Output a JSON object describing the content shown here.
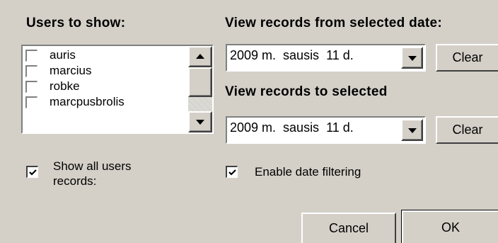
{
  "users_panel": {
    "heading": "Users to show:",
    "users": [
      {
        "name": "auris",
        "checked": false
      },
      {
        "name": "marcius",
        "checked": false
      },
      {
        "name": "robke",
        "checked": false
      },
      {
        "name": "marcpusbrolis",
        "checked": false
      }
    ],
    "show_all_label_line1": "Show all users",
    "show_all_label_line2": "records:",
    "show_all_checked": true
  },
  "date_from": {
    "heading": "View records from selected date:",
    "value": "2009 m.  sausis  11 d.",
    "clear_label": "Clear"
  },
  "date_to": {
    "heading": "View records to selected",
    "value": "2009 m.  sausis  11 d.",
    "clear_label": "Clear"
  },
  "enable_filter": {
    "label": "Enable date filtering",
    "checked": true
  },
  "buttons": {
    "cancel_label": "Cancel",
    "ok_label": "OK"
  },
  "icons": {
    "scroll_up": "triangle-up-icon",
    "scroll_down": "triangle-down-icon",
    "dropdown": "triangle-down-icon",
    "check": "check-icon"
  }
}
